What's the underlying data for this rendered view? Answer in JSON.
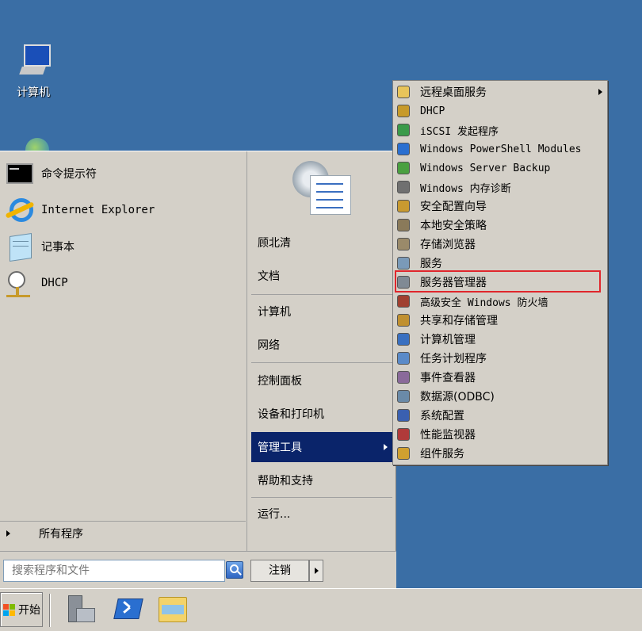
{
  "desktop": {
    "computer_label": "计算机"
  },
  "start_menu": {
    "pinned": [
      {
        "label": "命令提示符",
        "icon": "cmd-icon"
      },
      {
        "label": "Internet Explorer",
        "icon": "ie-icon"
      },
      {
        "label": "记事本",
        "icon": "notepad-icon"
      },
      {
        "label": "DHCP",
        "icon": "dhcp-icon"
      }
    ],
    "all_programs": "所有程序",
    "search_placeholder": "搜索程序和文件",
    "logoff": "注销",
    "right": {
      "user": "顾北清",
      "documents": "文档",
      "computer": "计算机",
      "network": "网络",
      "control_panel": "控制面板",
      "devices": "设备和打印机",
      "admin_tools": "管理工具",
      "help": "帮助和支持",
      "run": "运行..."
    }
  },
  "admin_tools": {
    "items": [
      {
        "label": "远程桌面服务",
        "icon": "folder-icon",
        "mono": false
      },
      {
        "label": "DHCP",
        "icon": "dhcp-icon",
        "mono": true
      },
      {
        "label": "iSCSI 发起程序",
        "icon": "globe-icon",
        "mono": true
      },
      {
        "label": "Windows PowerShell Modules",
        "icon": "powershell-icon",
        "mono": true
      },
      {
        "label": "Windows Server Backup",
        "icon": "backup-icon",
        "mono": true
      },
      {
        "label": "Windows 内存诊断",
        "icon": "memory-icon",
        "mono": true
      },
      {
        "label": "安全配置向导",
        "icon": "security-wizard-icon",
        "mono": false
      },
      {
        "label": "本地安全策略",
        "icon": "policy-icon",
        "mono": false
      },
      {
        "label": "存储浏览器",
        "icon": "storage-icon",
        "mono": false
      },
      {
        "label": "服务",
        "icon": "services-icon",
        "mono": false
      },
      {
        "label": "服务器管理器",
        "icon": "server-manager-icon",
        "mono": false
      },
      {
        "label": "高级安全 Windows 防火墙",
        "icon": "firewall-icon",
        "mono": true
      },
      {
        "label": "共享和存储管理",
        "icon": "share-icon",
        "mono": false
      },
      {
        "label": "计算机管理",
        "icon": "computer-management-icon",
        "mono": false
      },
      {
        "label": "任务计划程序",
        "icon": "task-scheduler-icon",
        "mono": false
      },
      {
        "label": "事件查看器",
        "icon": "event-viewer-icon",
        "mono": false
      },
      {
        "label": "数据源(ODBC)",
        "icon": "odbc-icon",
        "mono": false
      },
      {
        "label": "系统配置",
        "icon": "msconfig-icon",
        "mono": false
      },
      {
        "label": "性能监视器",
        "icon": "perfmon-icon",
        "mono": false
      },
      {
        "label": "组件服务",
        "icon": "component-icon",
        "mono": false
      }
    ]
  },
  "taskbar": {
    "start_label": "开始"
  }
}
